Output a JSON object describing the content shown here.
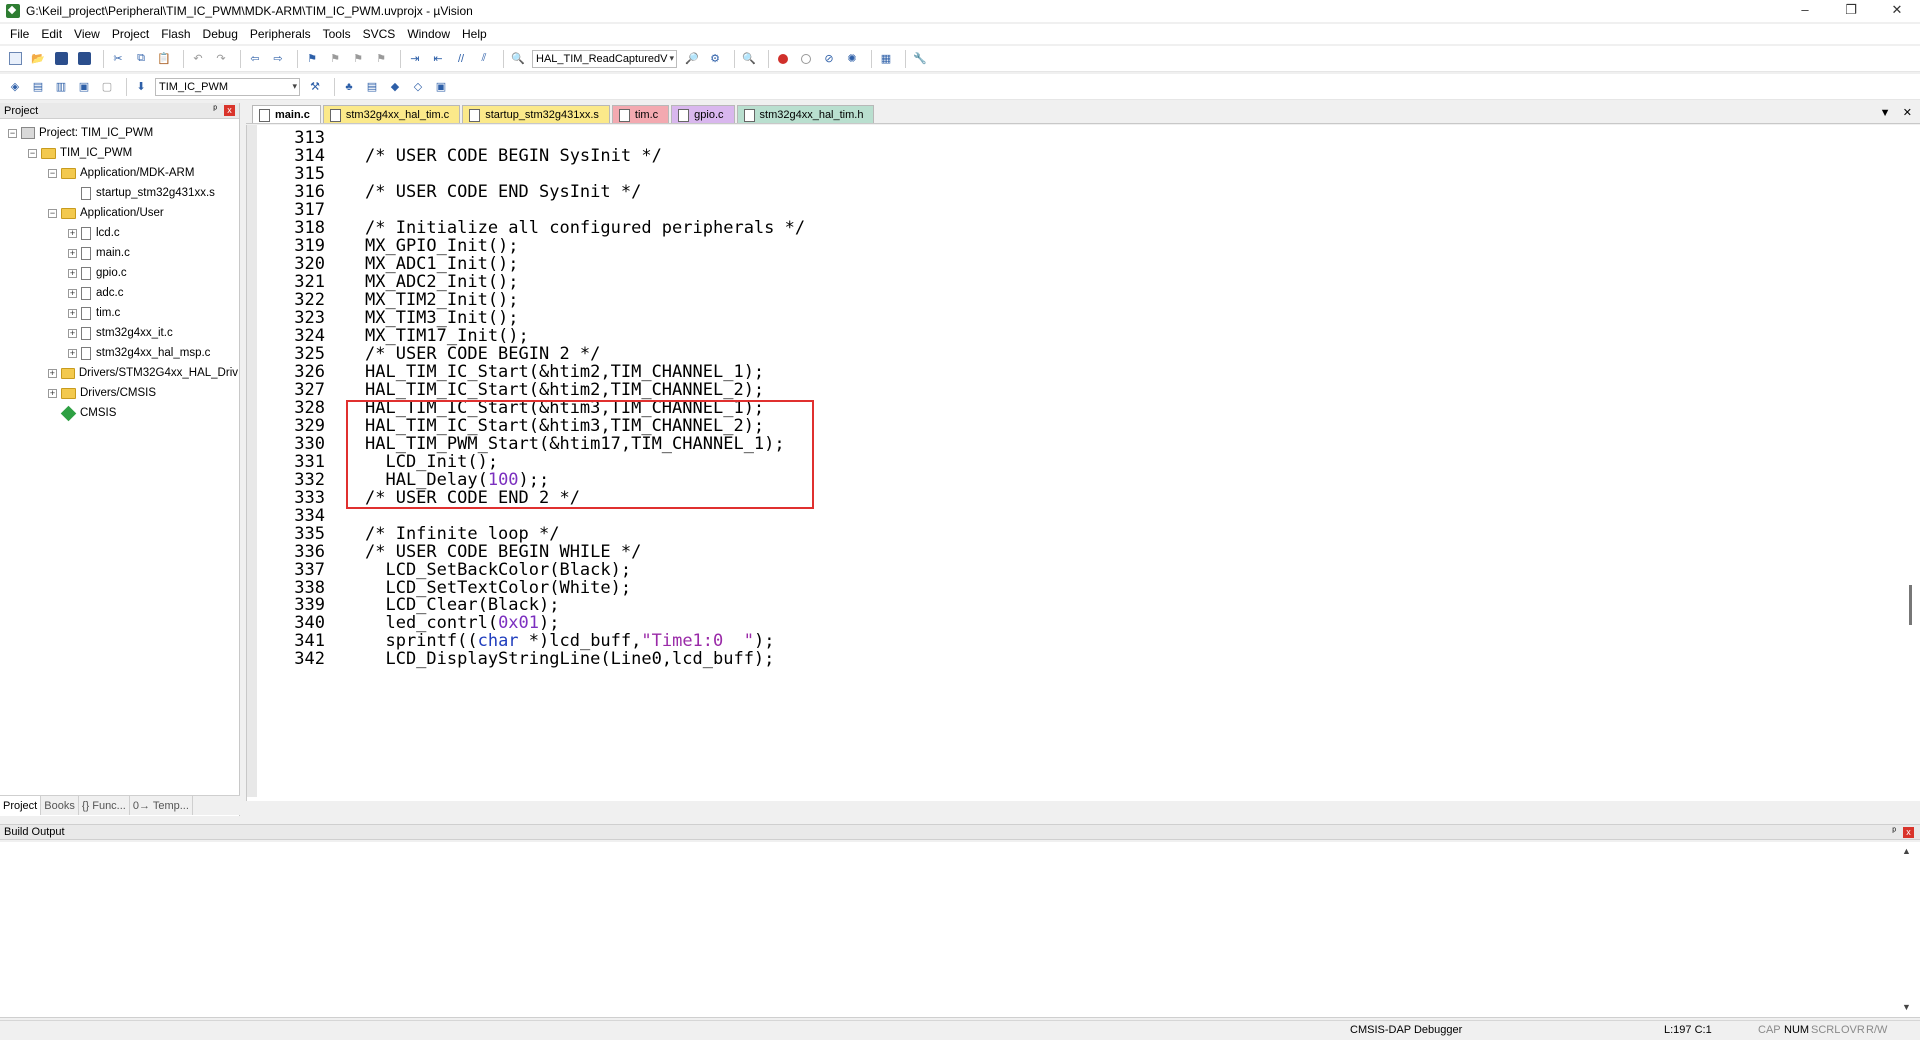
{
  "window": {
    "title": "G:\\Keil_project\\Peripheral\\TIM_IC_PWM\\MDK-ARM\\TIM_IC_PWM.uvprojx - µVision",
    "controls": [
      "–",
      "❐",
      "✕"
    ]
  },
  "menu": [
    "File",
    "Edit",
    "View",
    "Project",
    "Flash",
    "Debug",
    "Peripherals",
    "Tools",
    "SVCS",
    "Window",
    "Help"
  ],
  "toolbar": {
    "find_combo": "HAL_TIM_ReadCapturedV",
    "target_combo": "TIM_IC_PWM"
  },
  "project_panel": {
    "title": "Project",
    "pin": "ᵖ",
    "close": "x",
    "tree": [
      {
        "label": "Project: TIM_IC_PWM",
        "level": 0,
        "kind": "project",
        "exp": "−"
      },
      {
        "label": "TIM_IC_PWM",
        "level": 1,
        "kind": "folder",
        "exp": "−"
      },
      {
        "label": "Application/MDK-ARM",
        "level": 2,
        "kind": "folder",
        "exp": "−"
      },
      {
        "label": "startup_stm32g431xx.s",
        "level": 3,
        "kind": "file",
        "exp": ""
      },
      {
        "label": "Application/User",
        "level": 2,
        "kind": "folder",
        "exp": "−"
      },
      {
        "label": "lcd.c",
        "level": 3,
        "kind": "file",
        "exp": "+"
      },
      {
        "label": "main.c",
        "level": 3,
        "kind": "file",
        "exp": "+"
      },
      {
        "label": "gpio.c",
        "level": 3,
        "kind": "file",
        "exp": "+"
      },
      {
        "label": "adc.c",
        "level": 3,
        "kind": "file",
        "exp": "+"
      },
      {
        "label": "tim.c",
        "level": 3,
        "kind": "file",
        "exp": "+"
      },
      {
        "label": "stm32g4xx_it.c",
        "level": 3,
        "kind": "file",
        "exp": "+"
      },
      {
        "label": "stm32g4xx_hal_msp.c",
        "level": 3,
        "kind": "file",
        "exp": "+"
      },
      {
        "label": "Drivers/STM32G4xx_HAL_Driv",
        "level": 2,
        "kind": "folder",
        "exp": "+"
      },
      {
        "label": "Drivers/CMSIS",
        "level": 2,
        "kind": "folder",
        "exp": "+"
      },
      {
        "label": "CMSIS",
        "level": 2,
        "kind": "gem",
        "exp": ""
      }
    ],
    "tabs": [
      "Project",
      "Books",
      "{} Func...",
      "0→ Temp..."
    ]
  },
  "editor_tabs": [
    {
      "label": "main.c",
      "style": "active"
    },
    {
      "label": "stm32g4xx_hal_tim.c",
      "style": "yellow"
    },
    {
      "label": "startup_stm32g431xx.s",
      "style": "yellow"
    },
    {
      "label": "tim.c",
      "style": "red"
    },
    {
      "label": "gpio.c",
      "style": "purple"
    },
    {
      "label": "stm32g4xx_hal_tim.h",
      "style": "green"
    }
  ],
  "code": [
    {
      "n": "313",
      "t": ""
    },
    {
      "n": "314",
      "t": "/* USER CODE BEGIN SysInit */"
    },
    {
      "n": "315",
      "t": ""
    },
    {
      "n": "316",
      "t": "/* USER CODE END SysInit */"
    },
    {
      "n": "317",
      "t": ""
    },
    {
      "n": "318",
      "t": "/* Initialize all configured peripherals */"
    },
    {
      "n": "319",
      "t": "MX_GPIO_Init();"
    },
    {
      "n": "320",
      "t": "MX_ADC1_Init();"
    },
    {
      "n": "321",
      "t": "MX_ADC2_Init();"
    },
    {
      "n": "322",
      "t": "MX_TIM2_Init();"
    },
    {
      "n": "323",
      "t": "MX_TIM3_Init();"
    },
    {
      "n": "324",
      "t": "MX_TIM17_Init();"
    },
    {
      "n": "325",
      "t": "/* USER CODE BEGIN 2 */"
    },
    {
      "n": "326",
      "t": "HAL_TIM_IC_Start(&htim2,TIM_CHANNEL_1);"
    },
    {
      "n": "327",
      "t": "HAL_TIM_IC_Start(&htim2,TIM_CHANNEL_2);"
    },
    {
      "n": "328",
      "t": "HAL_TIM_IC_Start(&htim3,TIM_CHANNEL_1);"
    },
    {
      "n": "329",
      "t": "HAL_TIM_IC_Start(&htim3,TIM_CHANNEL_2);"
    },
    {
      "n": "330",
      "t": "HAL_TIM_PWM_Start(&htim17,TIM_CHANNEL_1);"
    },
    {
      "n": "331",
      "t": "  LCD_Init();"
    },
    {
      "n": "332",
      "t": "  HAL_Delay(100);;"
    },
    {
      "n": "333",
      "t": "/* USER CODE END 2 */"
    },
    {
      "n": "334",
      "t": ""
    },
    {
      "n": "335",
      "t": "/* Infinite loop */"
    },
    {
      "n": "336",
      "t": "/* USER CODE BEGIN WHILE */"
    },
    {
      "n": "337",
      "t": "  LCD_SetBackColor(Black);"
    },
    {
      "n": "338",
      "t": "  LCD_SetTextColor(White);"
    },
    {
      "n": "339",
      "t": "  LCD_Clear(Black);"
    },
    {
      "n": "340",
      "t": "  led_contrl(0x01);"
    },
    {
      "n": "341",
      "t": "  sprintf((char *)lcd_buff,\"Time1:0  \");"
    },
    {
      "n": "342",
      "t": "  LCD_DisplayStringLine(Line0,lcd_buff);"
    }
  ],
  "build_output": {
    "title": "Build Output",
    "pin": "ᵖ",
    "close": "x",
    "text": ""
  },
  "status": {
    "debugger": "CMSIS-DAP Debugger",
    "position": "L:197 C:1",
    "cap": "CAP",
    "num": "NUM",
    "scrl": "SCRL",
    "ovr": "OVR",
    "rw": "R/W"
  },
  "colors": {
    "comment": "#2e8b2e",
    "keyword": "#1f3dbd",
    "number": "#7b2fbf",
    "string": "#9a2aa8",
    "highlight_box": "#e0302f"
  }
}
